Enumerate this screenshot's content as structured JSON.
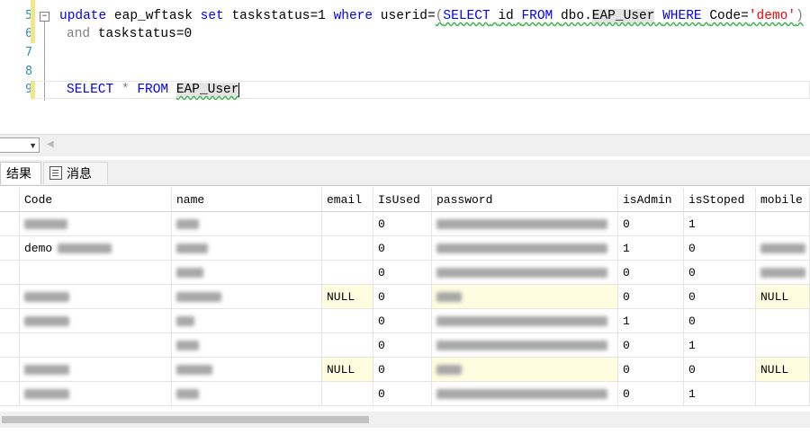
{
  "editor": {
    "line_numbers": [
      "5",
      "6",
      "7",
      "8",
      "9"
    ],
    "collapse_glyph": "−",
    "line5": {
      "kw_update": "update",
      "table1": "eap_wftask",
      "kw_set": "set",
      "assign": "taskstatus=1",
      "kw_where": "where",
      "col": "userid=",
      "paren_open": "(",
      "kw_select": "SELECT",
      "col_id": "id",
      "kw_from": "FROM",
      "schema": "dbo.",
      "table2": "EAP_User",
      "kw_where2": "WHERE",
      "col_code": "Code=",
      "str_demo": "'demo'",
      "paren_close": ")"
    },
    "line6": {
      "kw_and": "and",
      "cond": "taskstatus=0"
    },
    "line9": {
      "kw_select": "SELECT",
      "star": "*",
      "kw_from": "FROM",
      "table": "EAP_User"
    }
  },
  "zoom": {
    "value": "",
    "arrow": "▼",
    "scroll_left": "◀"
  },
  "tabs": {
    "results": "结果",
    "messages": "消息"
  },
  "grid": {
    "columns": [
      "Code",
      "name",
      "email",
      "IsUsed",
      "password",
      "isAdmin",
      "isStoped",
      "mobile"
    ],
    "rows": [
      {
        "code": "",
        "name": "",
        "email": "",
        "isused": "0",
        "password": "",
        "isadmin": "0",
        "isstoped": "1",
        "mobile": ""
      },
      {
        "code": "demo",
        "name": "",
        "email": "",
        "isused": "0",
        "password": "",
        "isadmin": "1",
        "isstoped": "0",
        "mobile": ""
      },
      {
        "code": "",
        "name": "",
        "email": "",
        "isused": "0",
        "password": "",
        "isadmin": "0",
        "isstoped": "0",
        "mobile": ""
      },
      {
        "code": "",
        "name": "",
        "email": "NULL",
        "isused": "0",
        "password": "",
        "isadmin": "0",
        "isstoped": "0",
        "mobile": "NULL"
      },
      {
        "code": "",
        "name": "",
        "email": "",
        "isused": "0",
        "password": "",
        "isadmin": "1",
        "isstoped": "0",
        "mobile": ""
      },
      {
        "code": "",
        "name": "",
        "email": "",
        "isused": "0",
        "password": "",
        "isadmin": "0",
        "isstoped": "1",
        "mobile": ""
      },
      {
        "code": "",
        "name": "",
        "email": "NULL",
        "isused": "0",
        "password": "",
        "isadmin": "0",
        "isstoped": "0",
        "mobile": "NULL"
      },
      {
        "code": "",
        "name": "",
        "email": "",
        "isused": "0",
        "password": "",
        "isadmin": "0",
        "isstoped": "1",
        "mobile": ""
      }
    ]
  },
  "colors": {
    "keyword": "#0000ff",
    "string": "#ff0000",
    "linenumber": "#2b91af",
    "null_bg": "#fffde0"
  }
}
